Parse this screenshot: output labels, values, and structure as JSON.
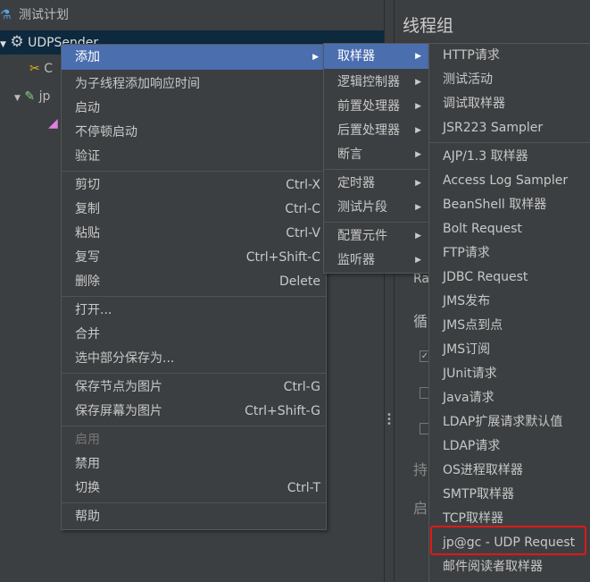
{
  "tree": {
    "items": [
      {
        "label": "测试计划",
        "icon": "flask-icon"
      },
      {
        "label": "UDPSender",
        "icon": "gear-icon",
        "selected": true
      },
      {
        "label": "C",
        "icon": "wrench-icon"
      },
      {
        "label": "jp",
        "icon": "pencil-icon"
      },
      {
        "label": "",
        "icon": "chart-icon"
      }
    ]
  },
  "right_panel": {
    "title": "线程组",
    "fragments": [
      "Ra",
      "循",
      "持",
      "启"
    ]
  },
  "context_menu": {
    "items": [
      {
        "label": "添加",
        "submenu": true
      },
      {
        "label": "为子线程添加响应时间"
      },
      {
        "label": "启动"
      },
      {
        "label": "不停顿启动"
      },
      {
        "label": "验证"
      },
      {
        "label": "剪切",
        "shortcut": "Ctrl-X"
      },
      {
        "label": "复制",
        "shortcut": "Ctrl-C"
      },
      {
        "label": "粘贴",
        "shortcut": "Ctrl-V"
      },
      {
        "label": "复写",
        "shortcut": "Ctrl+Shift-C"
      },
      {
        "label": "删除",
        "shortcut": "Delete"
      },
      {
        "label": "打开..."
      },
      {
        "label": "合并"
      },
      {
        "label": "选中部分保存为..."
      },
      {
        "label": "保存节点为图片",
        "shortcut": "Ctrl-G"
      },
      {
        "label": "保存屏幕为图片",
        "shortcut": "Ctrl+Shift-G"
      },
      {
        "label": "启用",
        "disabled": true
      },
      {
        "label": "禁用"
      },
      {
        "label": "切换",
        "shortcut": "Ctrl-T"
      },
      {
        "label": "帮助"
      }
    ]
  },
  "add_submenu": {
    "items": [
      "取样器",
      "逻辑控制器",
      "前置处理器",
      "后置处理器",
      "断言",
      "定时器",
      "测试片段",
      "配置元件",
      "监听器"
    ]
  },
  "sampler_submenu": {
    "items": [
      "HTTP请求",
      "测试活动",
      "调试取样器",
      "JSR223 Sampler",
      "AJP/1.3 取样器",
      "Access Log Sampler",
      "BeanShell 取样器",
      "Bolt Request",
      "FTP请求",
      "JDBC Request",
      "JMS发布",
      "JMS点到点",
      "JMS订阅",
      "JUnit请求",
      "Java请求",
      "LDAP扩展请求默认值",
      "LDAP请求",
      "OS进程取样器",
      "SMTP取样器",
      "TCP取样器",
      "jp@gc - UDP Request",
      "邮件阅读者取样器"
    ],
    "highlighted": "jp@gc - UDP Request"
  },
  "colors": {
    "background": "#3c3f41",
    "menu_highlight": "#4b6eaf",
    "tree_selection": "#0d293e",
    "annotation_box": "#e01818"
  }
}
